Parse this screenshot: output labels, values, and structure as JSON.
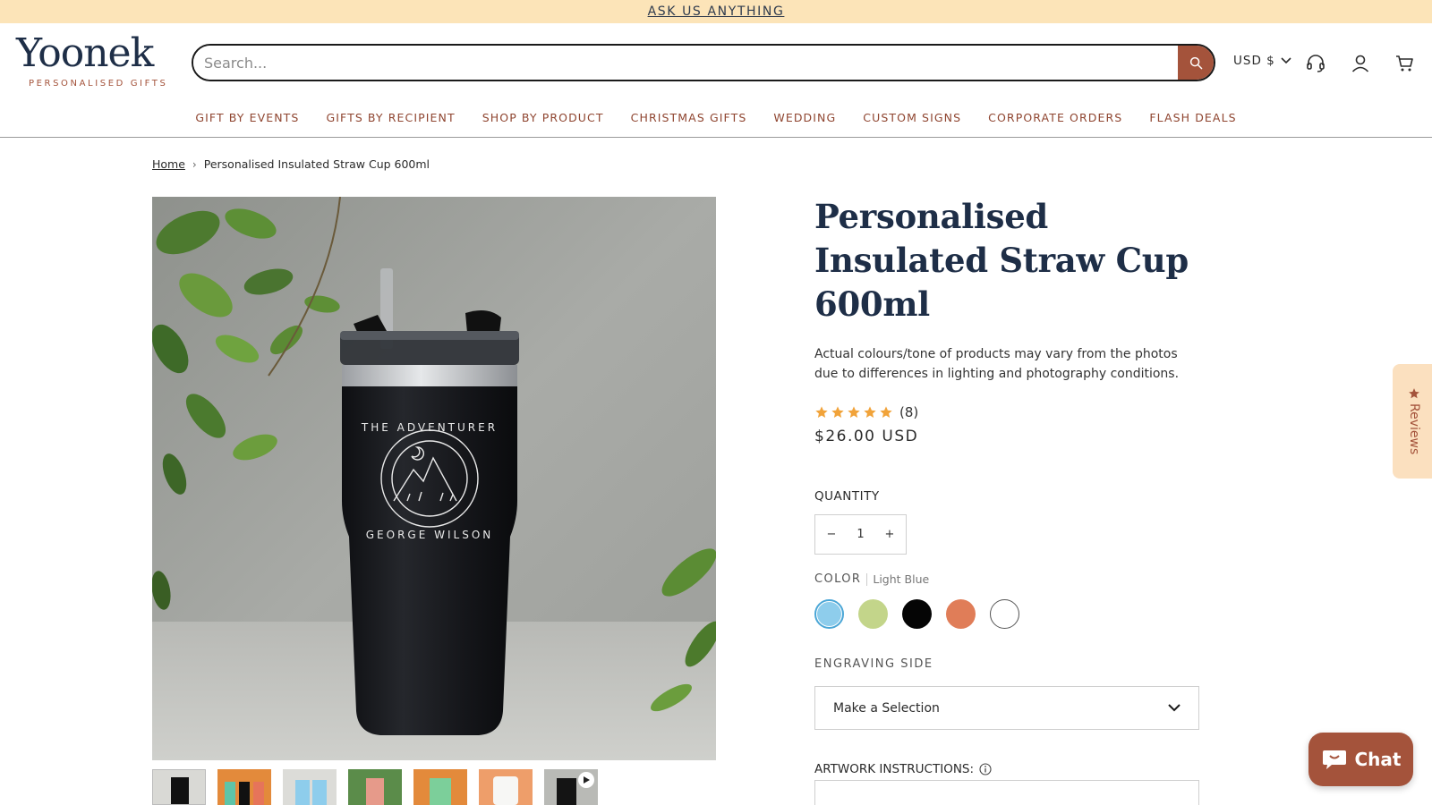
{
  "announcement": {
    "text": "ASK US ANYTHING"
  },
  "header": {
    "logo_word": "Yoonek",
    "logo_sub": "PERSONALISED GIFTS",
    "search_placeholder": "Search...",
    "currency": "USD $"
  },
  "nav": {
    "items": [
      "GIFT BY EVENTS",
      "GIFTS BY RECIPIENT",
      "SHOP BY PRODUCT",
      "CHRISTMAS GIFTS",
      "WEDDING",
      "CUSTOM SIGNS",
      "CORPORATE ORDERS",
      "FLASH DEALS"
    ]
  },
  "breadcrumb": {
    "home": "Home",
    "sep": "›",
    "current": "Personalised Insulated Straw Cup 600ml"
  },
  "product": {
    "title": "Personalised Insulated Straw Cup 600ml",
    "disclaimer": "Actual colours/tone of products may vary from the photos due to differences in lighting and photography conditions.",
    "rating": {
      "stars": 5,
      "count": "(8)"
    },
    "price": "$26.00 USD",
    "image_text": {
      "top": "THE ADVENTURER",
      "bottom": "GEORGE WILSON"
    },
    "quantity": {
      "label": "QUANTITY",
      "minus": "−",
      "value": "1",
      "plus": "+"
    },
    "color": {
      "label": "COLOR",
      "selected": "Light Blue",
      "swatches": [
        "#8ecdec",
        "#c3d58a",
        "#050505",
        "#e07d58",
        "#ffffff"
      ]
    },
    "engraving": {
      "label": "ENGRAVING SIDE",
      "value": "Make a Selection"
    },
    "artwork": {
      "label": "ARTWORK INSTRUCTIONS:"
    }
  },
  "reviews_tab": {
    "label": "Reviews"
  },
  "chat": {
    "label": "Chat"
  },
  "colors": {
    "accent": "#a4533b",
    "navy": "#1e2e47",
    "banner": "#fce4b8",
    "star": "#f1a33a"
  }
}
